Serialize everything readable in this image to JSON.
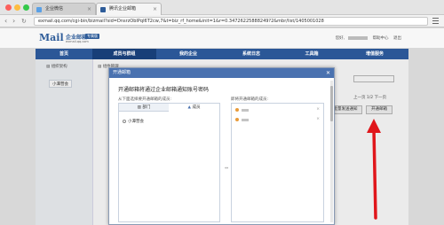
{
  "browser": {
    "tabs": [
      {
        "label": "企业微信",
        "favicon_color": "#5aa0e6"
      },
      {
        "label": "腾讯企业邮箱",
        "favicon_color": "#2e5c99"
      }
    ],
    "url": "exmail.qq.com/cgi-bin/bizmail?sid=DnsrzObIPqI6T2cw,7&t=biz_rf_home&init=1&r=0.34726225888249?2&mbr/list/1405001028"
  },
  "app": {
    "logo": "Mail",
    "logo_cn": "企业邮箱",
    "logo_badge": "专属版",
    "logo_domain": "exmail.qq.com",
    "top_links": [
      "您好,",
      "帮助中心",
      "退出"
    ],
    "nav": [
      {
        "label": "首页"
      },
      {
        "label": "成员与群组",
        "active": true
      },
      {
        "label": "我的企业"
      },
      {
        "label": "系统日志"
      },
      {
        "label": "工具箱"
      },
      {
        "label": "增值服务"
      }
    ],
    "subtabs": [
      "组织架构",
      "组件管理"
    ],
    "department_pill": "小潭营会",
    "page_nav": "上一页 1/2 下一页",
    "buttons": {
      "batch_notify": "批量发送通知",
      "enable_mail": "开通邮箱"
    }
  },
  "modal": {
    "header": "开通邮箱",
    "close": "✕",
    "title": "开通邮箱将通过企业邮箱通知账号密码",
    "left_label": "从下面选择要开通邮箱的成员:",
    "right_label": "即将开通邮箱的成员:",
    "tab_department": "部门",
    "tab_members": "成员",
    "department_item": "小潭营会",
    "selected_members": [
      {
        "remove": "×"
      },
      {
        "remove": "×"
      }
    ],
    "move_symbol": "⇔"
  },
  "colors": {
    "nav_bg": "#2b5797",
    "modal_header": "#4a72b0",
    "arrow": "#e0161b"
  }
}
